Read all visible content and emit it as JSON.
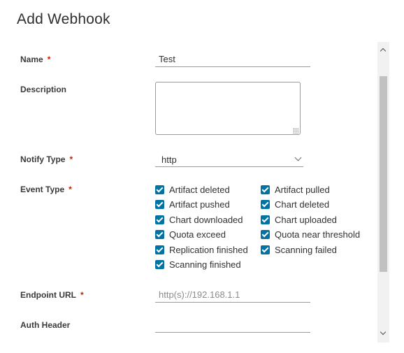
{
  "dialog": {
    "title": "Add Webhook"
  },
  "form": {
    "name": {
      "label": "Name",
      "required_mark": "*",
      "value": "Test"
    },
    "description": {
      "label": "Description",
      "value": ""
    },
    "notify_type": {
      "label": "Notify Type",
      "required_mark": "*",
      "selected": "http"
    },
    "event_type": {
      "label": "Event Type",
      "required_mark": "*",
      "options": [
        {
          "label": "Artifact deleted",
          "checked": true
        },
        {
          "label": "Artifact pulled",
          "checked": true
        },
        {
          "label": "Artifact pushed",
          "checked": true
        },
        {
          "label": "Chart deleted",
          "checked": true
        },
        {
          "label": "Chart downloaded",
          "checked": true
        },
        {
          "label": "Chart uploaded",
          "checked": true
        },
        {
          "label": "Quota exceed",
          "checked": true
        },
        {
          "label": "Quota near threshold",
          "checked": true
        },
        {
          "label": "Replication finished",
          "checked": true
        },
        {
          "label": "Scanning failed",
          "checked": true
        },
        {
          "label": "Scanning finished",
          "checked": true
        }
      ]
    },
    "endpoint_url": {
      "label": "Endpoint URL",
      "required_mark": "*",
      "placeholder": "http(s)://192.168.1.1",
      "value": ""
    },
    "auth_header": {
      "label": "Auth Header",
      "value": ""
    }
  },
  "colors": {
    "accent": "#0072a3",
    "required": "#c92100"
  }
}
